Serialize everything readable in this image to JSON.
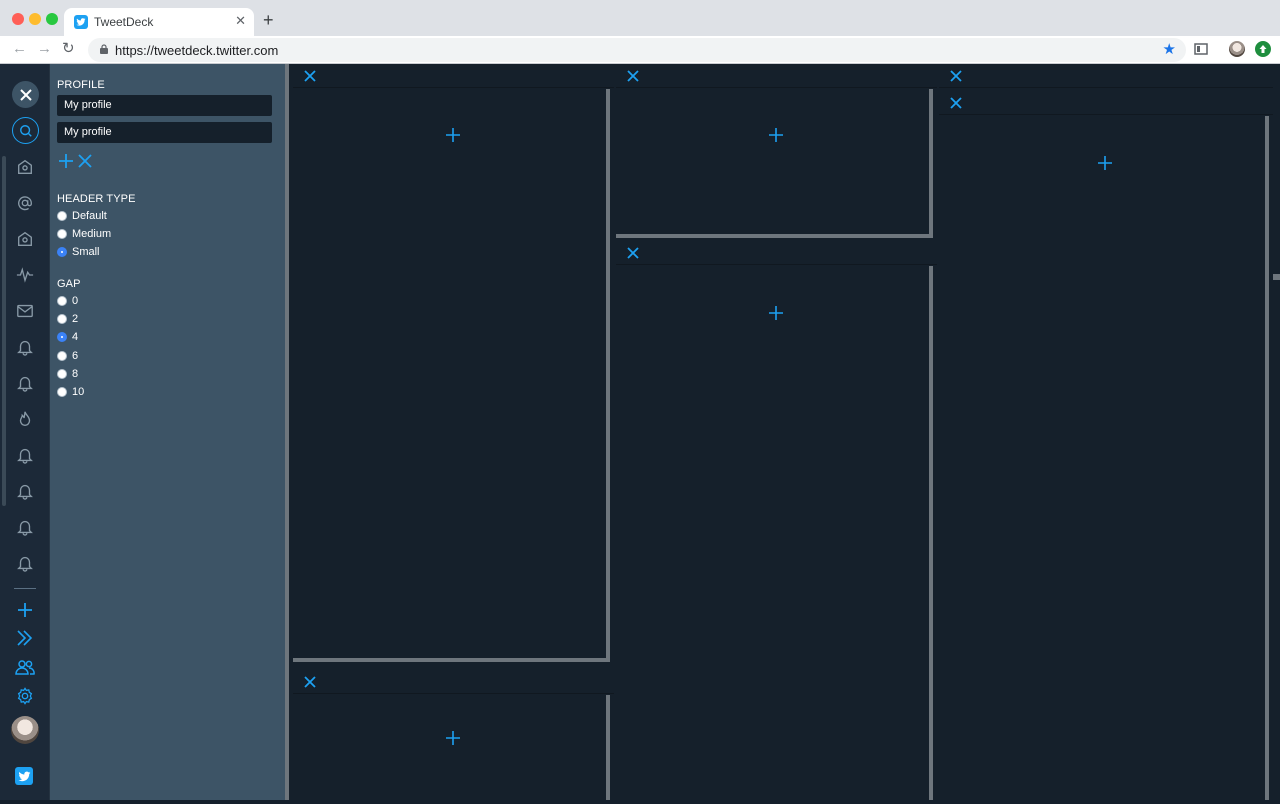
{
  "browser": {
    "tab_title": "TweetDeck",
    "tab_close": "✕",
    "new_tab": "+",
    "url": "https://tweetdeck.twitter.com",
    "back": "←",
    "forward": "→",
    "reload": "↻",
    "bookmark": "★"
  },
  "nav_icons": [
    "close-icon",
    "search-icon",
    "home-icon",
    "mention-icon",
    "home-icon",
    "activity-icon",
    "mail-icon",
    "bell-icon",
    "bell-icon",
    "flame-icon",
    "bell-icon",
    "bell-icon",
    "bell-icon",
    "bell-icon",
    "add-icon",
    "expand-icon",
    "accounts-icon",
    "gear-icon"
  ],
  "settings": {
    "profile_label": "PROFILE",
    "profiles": [
      "My profile",
      "My profile"
    ],
    "header_type_label": "HEADER TYPE",
    "header_types": [
      {
        "label": "Default",
        "checked": false
      },
      {
        "label": "Medium",
        "checked": false
      },
      {
        "label": "Small",
        "checked": true
      }
    ],
    "gap_label": "GAP",
    "gaps": [
      {
        "label": "0",
        "checked": false
      },
      {
        "label": "2",
        "checked": false
      },
      {
        "label": "4",
        "checked": true
      },
      {
        "label": "6",
        "checked": false
      },
      {
        "label": "8",
        "checked": false
      },
      {
        "label": "10",
        "checked": false
      }
    ]
  },
  "colors": {
    "accent": "#1da1f2",
    "background": "#15202b",
    "panel": "#3d5466",
    "divider": "#6e767d"
  }
}
